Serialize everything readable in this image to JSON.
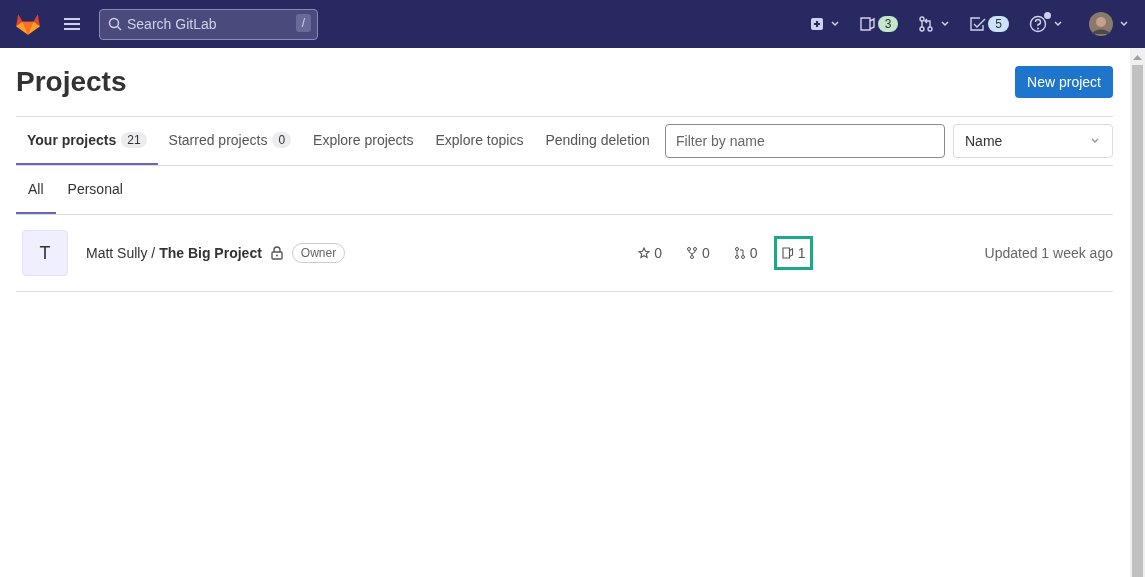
{
  "header": {
    "search": {
      "placeholder": "Search GitLab",
      "shortcut": "/"
    },
    "actions": [
      {
        "kind": "create"
      },
      {
        "kind": "issues",
        "count": "3",
        "color": "#c3e6cd"
      },
      {
        "kind": "merge"
      },
      {
        "kind": "todos",
        "count": "5",
        "color": "#cbe2f9"
      },
      {
        "kind": "help",
        "dot": true
      },
      {
        "kind": "avatar"
      }
    ]
  },
  "page": {
    "title": "Projects",
    "new_button": "New project"
  },
  "tabs": [
    {
      "label": "Your projects",
      "count": "21",
      "selected": true
    },
    {
      "label": "Starred projects",
      "count": "0",
      "selected": false
    },
    {
      "label": "Explore projects",
      "selected": false
    },
    {
      "label": "Explore topics",
      "selected": false
    },
    {
      "label": "Pending deletion",
      "selected": false
    }
  ],
  "filter": {
    "placeholder": "Filter by name"
  },
  "sort": {
    "value": "Name"
  },
  "subtabs": [
    {
      "label": "All",
      "selected": true
    },
    {
      "label": "Personal",
      "selected": false
    }
  ],
  "projects": [
    {
      "avatar": "T",
      "name": "Matt Sully / **The Big Project**",
      "private": true,
      "role": "Owner",
      "stats": [
        {
          "kind": "stars",
          "value": "0",
          "highlighted": false
        },
        {
          "kind": "forks",
          "value": "0",
          "highlighted": false
        },
        {
          "kind": "merge_requests",
          "value": "0",
          "highlighted": false
        },
        {
          "kind": "issues",
          "value": "1",
          "highlighted": true
        }
      ],
      "updated": "Updated 1 week ago"
    }
  ]
}
